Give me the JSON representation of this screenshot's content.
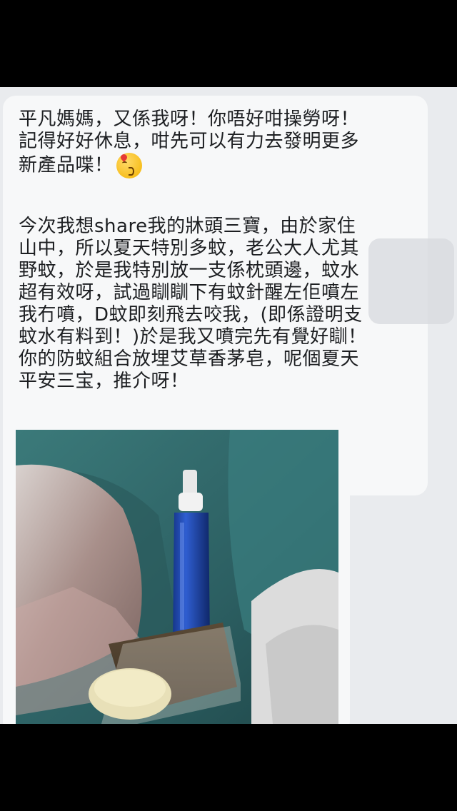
{
  "message": {
    "paragraph1": [
      "平凡媽媽，又係我呀！你唔好咁操勞呀！",
      "記得好好休息，咁先可以有力去發明更多",
      "新產品喋！"
    ],
    "paragraph2": [
      "今次我想share我的牀頭三寶，由於家住",
      "山中，所以夏天特別多蚊，老公大人尤其",
      "野蚊，於是我特別放一支係枕頭邊，蚊水",
      "超有效呀，試過瞓瞓下有蚊針醒左佢噴左",
      "我冇噴，D蚊即刻飛去咬我，(即係證明支",
      "蚊水有料到！)於是我又噴完先有覺好瞓！",
      "你的防蚊組合放埋艾草香茅皂，呢個夏天",
      "平安三宝，推介呀！"
    ],
    "emoji": "kissing-heart-emoji"
  },
  "photo": {
    "subject": "bedside-mosquito-spray-and-soap-photo"
  },
  "colors": {
    "chat_background": "#e9ebee",
    "bubble": "#f7f8f9",
    "text": "#1c1e21",
    "frame": "#000000"
  }
}
